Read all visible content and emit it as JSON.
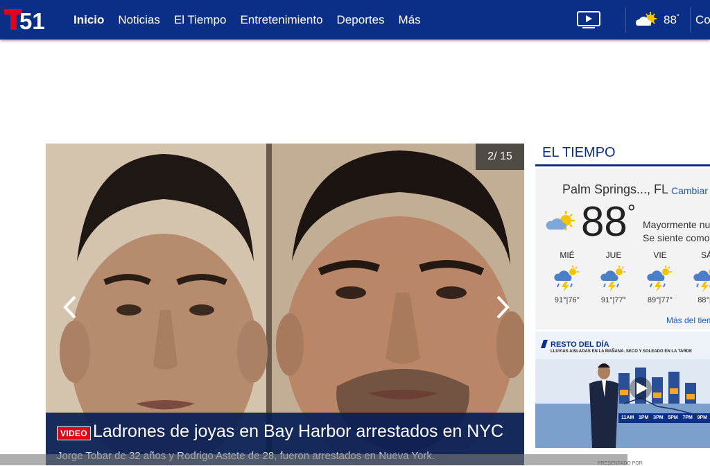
{
  "header": {
    "logo_text": "T51",
    "nav": [
      "Inicio",
      "Noticias",
      "El Tiempo",
      "Entretenimiento",
      "Deportes",
      "Más"
    ],
    "weather_temp": "88",
    "truncated_link": "Co"
  },
  "hero": {
    "counter": "2/ 15",
    "badge": "VIDEO",
    "headline": "Ladrones de joyas en Bay Harbor arrestados en NYC",
    "subline": "Jorge Tobar de 32 años y Rodrigo Astete de 28, fueron arrestados en Nueva York."
  },
  "weather": {
    "section_title": "EL TIEMPO",
    "location": "Palm Springs..., FL",
    "change_label": "Cambiar",
    "current_temp": "88",
    "condition_line1": "Mayormente nu",
    "condition_line2": "Se siente como",
    "forecast": [
      {
        "day": "MIÉ",
        "temps": "91°|76°"
      },
      {
        "day": "JUE",
        "temps": "91°|77°"
      },
      {
        "day": "VIE",
        "temps": "89°|77°"
      },
      {
        "day": "SÁ",
        "temps": "88°|7"
      }
    ],
    "more_link": "Más del tiem"
  },
  "video": {
    "title": "RESTO DEL DÍA",
    "subtitle": "LLUVIAS AISLADAS EN LA MAÑANA. SECO Y SOLEADO EN LA TARDE",
    "times": [
      "11AM",
      "1PM",
      "3PM",
      "5PM",
      "7PM",
      "9PM"
    ]
  },
  "footer": {
    "presented": "PRESENTADO POR"
  }
}
